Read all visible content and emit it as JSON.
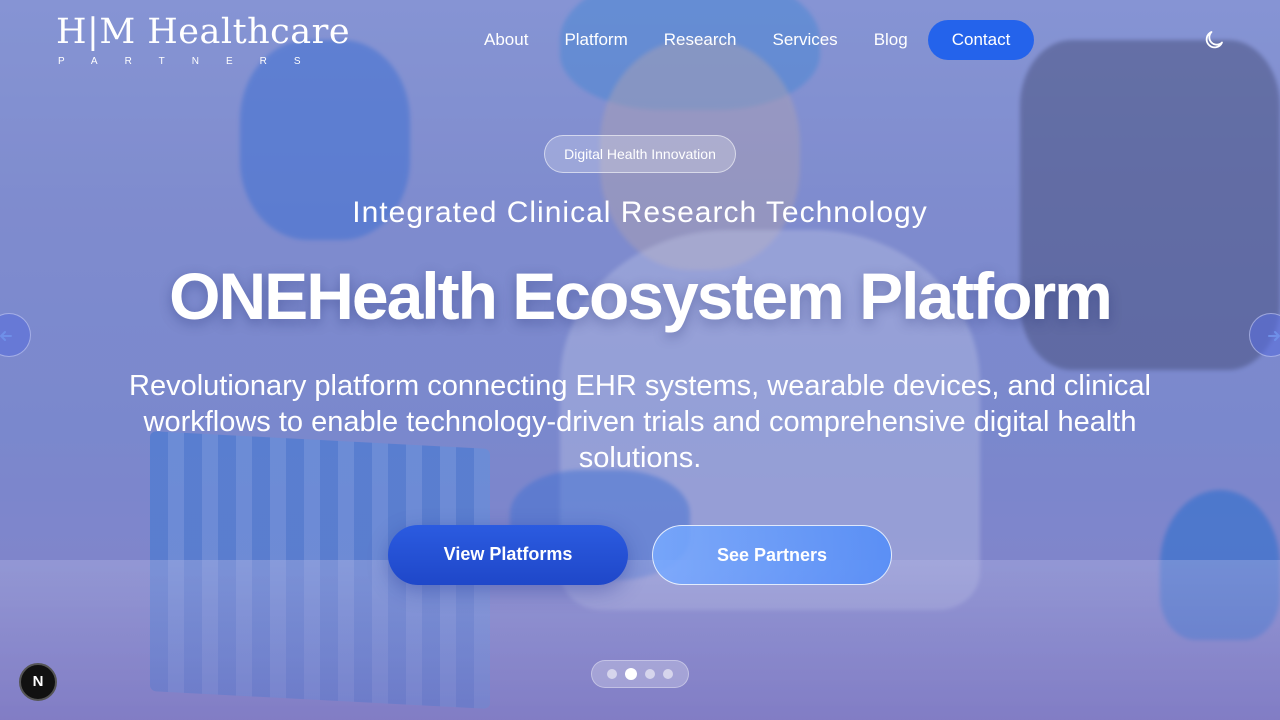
{
  "header": {
    "logo": {
      "main": "H|M Healthcare",
      "sub": "PARTNERS"
    },
    "nav": [
      {
        "label": "About"
      },
      {
        "label": "Platform"
      },
      {
        "label": "Research"
      },
      {
        "label": "Services"
      },
      {
        "label": "Blog"
      }
    ],
    "contact_label": "Contact",
    "theme_toggle_icon": "moon-icon"
  },
  "hero": {
    "badge": "Digital Health Innovation",
    "subtitle": "Integrated Clinical Research Technology",
    "title": "ONEHealth Ecosystem Platform",
    "description": "Revolutionary platform connecting EHR systems, wearable devices, and clinical workflows to enable technology-driven trials and comprehensive digital health solutions.",
    "primary_button": "View Platforms",
    "secondary_button": "See Partners",
    "slides": {
      "count": 4,
      "active_index": 1
    }
  },
  "dev_badge": "N",
  "colors": {
    "accent": "#2463eb",
    "primary_button": "#2b5be0"
  }
}
